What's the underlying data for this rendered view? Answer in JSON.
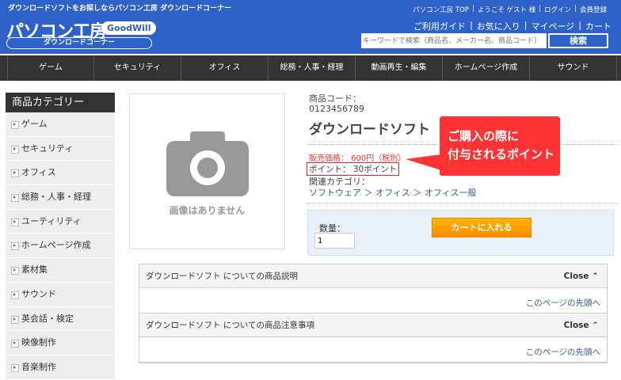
{
  "header": {
    "tagline": "ダウンロードソフトをお探しならパソコン工房 ダウンロードコーナー",
    "logo": "パソコン工房",
    "logo_badge": "GoodWill",
    "corner": "ダウンロードコーナー",
    "top_links": [
      "パソコン工房 TOP",
      "ようこそ ゲスト 様",
      "ログイン",
      "会員登録"
    ],
    "sub_links": [
      "ご利用ガイド",
      "お気に入り",
      "マイページ",
      "カート"
    ],
    "search_placeholder": "キーワードで検索（商品名、メーカー名、商品コード）",
    "search_button": "検索"
  },
  "nav": [
    "ゲーム",
    "セキュリティ",
    "オフィス",
    "総務・人事・経理",
    "動画再生・編集",
    "ホームページ作成",
    "サウンド"
  ],
  "sidebar": {
    "title": "商品カテゴリー",
    "items": [
      "ゲーム",
      "セキュリティ",
      "オフィス",
      "総務・人事・経理",
      "ユーティリティ",
      "ホームページ作成",
      "素材集",
      "サウンド",
      "英会話・検定",
      "映像制作",
      "音楽制作"
    ]
  },
  "product": {
    "no_image": "画像はありません",
    "code_label": "商品コード：",
    "code": "0123456789",
    "name": "ダウンロードソフト",
    "price": "販売価格： 600円（税別）",
    "point": "ポイント： 30ポイント",
    "category_label": "関連カテゴリ：",
    "category_path": "ソフトウェア ＞ オフィス ＞ オフィス一般",
    "qty_label": "数量：",
    "qty": "1",
    "cart_button": "カートに入れる"
  },
  "callout": {
    "line1": "ご購入の際に",
    "line2": "付与されるポイント"
  },
  "accordion": [
    {
      "title": "ダウンロードソフト についての商品説明",
      "close": "Close",
      "link": "このページの先頭へ"
    },
    {
      "title": "ダウンロードソフト についての商品注意事項",
      "close": "Close",
      "link": "このページの先頭へ"
    }
  ]
}
